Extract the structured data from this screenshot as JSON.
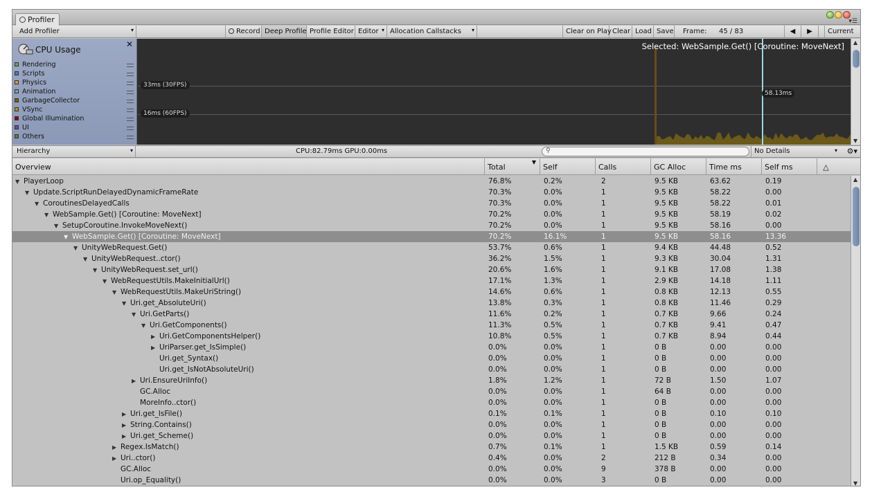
{
  "tab": {
    "title": "Profiler"
  },
  "toolbar": {
    "add_profiler": "Add Profiler",
    "record": "Record",
    "deep_profile": "Deep Profile",
    "profile_editor": "Profile Editor",
    "editor": "Editor",
    "allocation_callstacks": "Allocation Callstacks",
    "clear_on_play": "Clear on Play",
    "clear": "Clear",
    "load": "Load",
    "save": "Save",
    "frame_label": "Frame:",
    "frame_value": "45 / 83",
    "current": "Current"
  },
  "legend": {
    "title": "CPU Usage",
    "items": [
      {
        "label": "Rendering",
        "color": "#6aa84f"
      },
      {
        "label": "Scripts",
        "color": "#3d85c6"
      },
      {
        "label": "Physics",
        "color": "#e69138"
      },
      {
        "label": "Animation",
        "color": "#76a5af"
      },
      {
        "label": "GarbageCollector",
        "color": "#7f6000"
      },
      {
        "label": "VSync",
        "color": "#bf9000"
      },
      {
        "label": "Global Illumination",
        "color": "#990000"
      },
      {
        "label": "UI",
        "color": "#674ea7"
      },
      {
        "label": "Others",
        "color": "#6d7a2c"
      }
    ]
  },
  "graph": {
    "line30": "33ms (30FPS)",
    "line60": "16ms (60FPS)",
    "selected": "Selected: WebSample.Get() [Coroutine: MoveNext]",
    "time_label": "58.13ms",
    "fill_color": "#6b5a1a"
  },
  "hierarchy_bar": {
    "mode": "Hierarchy",
    "cpu_gpu": "CPU:82.79ms   GPU:0.00ms",
    "details": "No Details"
  },
  "columns": [
    "Overview",
    "Total",
    "Self",
    "Calls",
    "GC Alloc",
    "Time ms",
    "Self ms"
  ],
  "rows": [
    {
      "depth": 0,
      "exp": "open",
      "name": "PlayerLoop",
      "total": "76.8%",
      "self": "0.2%",
      "calls": "2",
      "gc": "9.5 KB",
      "time": "63.62",
      "selfms": "0.19"
    },
    {
      "depth": 1,
      "exp": "open",
      "name": "Update.ScriptRunDelayedDynamicFrameRate",
      "total": "70.3%",
      "self": "0.0%",
      "calls": "1",
      "gc": "9.5 KB",
      "time": "58.22",
      "selfms": "0.00"
    },
    {
      "depth": 2,
      "exp": "open",
      "name": "CoroutinesDelayedCalls",
      "total": "70.3%",
      "self": "0.0%",
      "calls": "1",
      "gc": "9.5 KB",
      "time": "58.22",
      "selfms": "0.01"
    },
    {
      "depth": 3,
      "exp": "open",
      "name": "WebSample.Get() [Coroutine: MoveNext]",
      "total": "70.2%",
      "self": "0.0%",
      "calls": "1",
      "gc": "9.5 KB",
      "time": "58.19",
      "selfms": "0.02"
    },
    {
      "depth": 4,
      "exp": "open",
      "name": "SetupCoroutine.InvokeMoveNext()",
      "total": "70.2%",
      "self": "0.0%",
      "calls": "1",
      "gc": "9.5 KB",
      "time": "58.16",
      "selfms": "0.00"
    },
    {
      "depth": 5,
      "exp": "open",
      "name": "WebSample.Get() [Coroutine: MoveNext]",
      "total": "70.2%",
      "self": "16.1%",
      "calls": "1",
      "gc": "9.5 KB",
      "time": "58.16",
      "selfms": "13.36",
      "selected": true
    },
    {
      "depth": 6,
      "exp": "open",
      "name": "UnityWebRequest.Get()",
      "total": "53.7%",
      "self": "0.6%",
      "calls": "1",
      "gc": "9.4 KB",
      "time": "44.48",
      "selfms": "0.52"
    },
    {
      "depth": 7,
      "exp": "open",
      "name": "UnityWebRequest..ctor()",
      "total": "36.2%",
      "self": "1.5%",
      "calls": "1",
      "gc": "9.3 KB",
      "time": "30.04",
      "selfms": "1.31"
    },
    {
      "depth": 8,
      "exp": "open",
      "name": "UnityWebRequest.set_url()",
      "total": "20.6%",
      "self": "1.6%",
      "calls": "1",
      "gc": "9.1 KB",
      "time": "17.08",
      "selfms": "1.38"
    },
    {
      "depth": 9,
      "exp": "open",
      "name": "WebRequestUtils.MakeInitialUrl()",
      "total": "17.1%",
      "self": "1.3%",
      "calls": "1",
      "gc": "2.9 KB",
      "time": "14.18",
      "selfms": "1.11"
    },
    {
      "depth": 10,
      "exp": "open",
      "name": "WebRequestUtils.MakeUriString()",
      "total": "14.6%",
      "self": "0.6%",
      "calls": "1",
      "gc": "0.8 KB",
      "time": "12.13",
      "selfms": "0.55"
    },
    {
      "depth": 11,
      "exp": "open",
      "name": "Uri.get_AbsoluteUri()",
      "total": "13.8%",
      "self": "0.3%",
      "calls": "1",
      "gc": "0.8 KB",
      "time": "11.46",
      "selfms": "0.29"
    },
    {
      "depth": 12,
      "exp": "open",
      "name": "Uri.GetParts()",
      "total": "11.6%",
      "self": "0.2%",
      "calls": "1",
      "gc": "0.7 KB",
      "time": "9.66",
      "selfms": "0.24"
    },
    {
      "depth": 13,
      "exp": "open",
      "name": "Uri.GetComponents()",
      "total": "11.3%",
      "self": "0.5%",
      "calls": "1",
      "gc": "0.7 KB",
      "time": "9.41",
      "selfms": "0.47"
    },
    {
      "depth": 14,
      "exp": "closed",
      "name": "Uri.GetComponentsHelper()",
      "total": "10.8%",
      "self": "0.5%",
      "calls": "1",
      "gc": "0.7 KB",
      "time": "8.94",
      "selfms": "0.44"
    },
    {
      "depth": 14,
      "exp": "closed",
      "name": "UriParser.get_IsSimple()",
      "total": "0.0%",
      "self": "0.0%",
      "calls": "1",
      "gc": "0 B",
      "time": "0.00",
      "selfms": "0.00"
    },
    {
      "depth": 14,
      "exp": "none",
      "name": "Uri.get_Syntax()",
      "total": "0.0%",
      "self": "0.0%",
      "calls": "1",
      "gc": "0 B",
      "time": "0.00",
      "selfms": "0.00"
    },
    {
      "depth": 14,
      "exp": "none",
      "name": "Uri.get_IsNotAbsoluteUri()",
      "total": "0.0%",
      "self": "0.0%",
      "calls": "1",
      "gc": "0 B",
      "time": "0.00",
      "selfms": "0.00"
    },
    {
      "depth": 12,
      "exp": "closed",
      "name": "Uri.EnsureUriInfo()",
      "total": "1.8%",
      "self": "1.2%",
      "calls": "1",
      "gc": "72 B",
      "time": "1.50",
      "selfms": "1.07"
    },
    {
      "depth": 12,
      "exp": "none",
      "name": "GC.Alloc",
      "total": "0.0%",
      "self": "0.0%",
      "calls": "1",
      "gc": "64 B",
      "time": "0.00",
      "selfms": "0.00"
    },
    {
      "depth": 12,
      "exp": "none",
      "name": "MoreInfo..ctor()",
      "total": "0.0%",
      "self": "0.0%",
      "calls": "1",
      "gc": "0 B",
      "time": "0.00",
      "selfms": "0.00"
    },
    {
      "depth": 11,
      "exp": "closed",
      "name": "Uri.get_IsFile()",
      "total": "0.1%",
      "self": "0.1%",
      "calls": "1",
      "gc": "0 B",
      "time": "0.10",
      "selfms": "0.10"
    },
    {
      "depth": 11,
      "exp": "closed",
      "name": "String.Contains()",
      "total": "0.0%",
      "self": "0.0%",
      "calls": "1",
      "gc": "0 B",
      "time": "0.00",
      "selfms": "0.00"
    },
    {
      "depth": 11,
      "exp": "closed",
      "name": "Uri.get_Scheme()",
      "total": "0.0%",
      "self": "0.0%",
      "calls": "1",
      "gc": "0 B",
      "time": "0.00",
      "selfms": "0.00"
    },
    {
      "depth": 10,
      "exp": "closed",
      "name": "Regex.IsMatch()",
      "total": "0.7%",
      "self": "0.1%",
      "calls": "1",
      "gc": "1.5 KB",
      "time": "0.59",
      "selfms": "0.14"
    },
    {
      "depth": 10,
      "exp": "closed",
      "name": "Uri..ctor()",
      "total": "0.4%",
      "self": "0.0%",
      "calls": "2",
      "gc": "212 B",
      "time": "0.34",
      "selfms": "0.00"
    },
    {
      "depth": 10,
      "exp": "none",
      "name": "GC.Alloc",
      "total": "0.0%",
      "self": "0.0%",
      "calls": "9",
      "gc": "378 B",
      "time": "0.00",
      "selfms": "0.00"
    },
    {
      "depth": 10,
      "exp": "none",
      "name": "Uri.op_Equality()",
      "total": "0.0%",
      "self": "0.0%",
      "calls": "3",
      "gc": "0 B",
      "time": "0.00",
      "selfms": "0.00"
    }
  ]
}
